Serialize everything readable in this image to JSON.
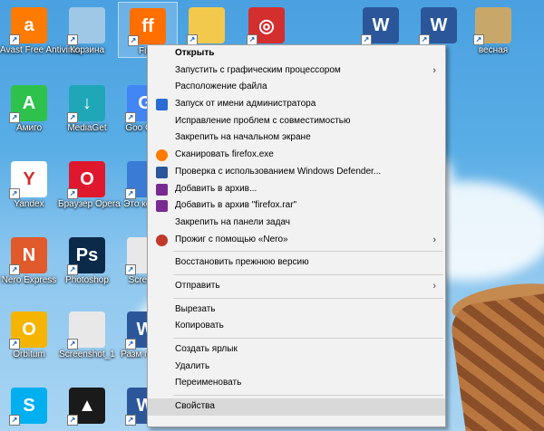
{
  "desktop_icons": [
    {
      "label": "Avast Free Antivirus",
      "color": "#ff7a00",
      "glyph": "a"
    },
    {
      "label": "Корзина",
      "color": "#9fc8e6",
      "glyph": ""
    },
    {
      "label": "Firef",
      "color": "#ff6f00",
      "glyph": "ff"
    },
    {
      "label": "",
      "color": "#f2c94c",
      "glyph": ""
    },
    {
      "label": "",
      "color": "#d32f2f",
      "glyph": "◎"
    },
    {
      "label": "",
      "color": "#2b579a",
      "glyph": "W"
    },
    {
      "label": "",
      "color": "#2b579a",
      "glyph": "W"
    },
    {
      "label": "весная",
      "color": "#c8a86a",
      "glyph": ""
    },
    {
      "label": "Амиго",
      "color": "#2ec24c",
      "glyph": "A"
    },
    {
      "label": "MediaGet",
      "color": "#1fa7b8",
      "glyph": "↓"
    },
    {
      "label": "Goo Chro",
      "color": "#4285f4",
      "glyph": "G"
    },
    {
      "label": "Yandex",
      "color": "#ffffff",
      "glyph": "Y"
    },
    {
      "label": "Браузер Opera",
      "color": "#e0182d",
      "glyph": "O"
    },
    {
      "label": "Это компь",
      "color": "#3a7bd5",
      "glyph": ""
    },
    {
      "label": "Nero Express",
      "color": "#e05a2b",
      "glyph": "N"
    },
    {
      "label": "Photoshop",
      "color": "#0b2a4a",
      "glyph": "Ps"
    },
    {
      "label": "Screens",
      "color": "#e8e8e8",
      "glyph": ""
    },
    {
      "label": "Orbitum",
      "color": "#f4b400",
      "glyph": "O"
    },
    {
      "label": "Screenshot_1",
      "color": "#e8e8e8",
      "glyph": ""
    },
    {
      "label": "Разм перед",
      "color": "#2b579a",
      "glyph": "W"
    },
    {
      "label": "",
      "color": "#00aff0",
      "glyph": "S"
    },
    {
      "label": "",
      "color": "#1a1a1a",
      "glyph": "▲"
    },
    {
      "label": "",
      "color": "#2b579a",
      "glyph": "W"
    }
  ],
  "menu": {
    "items": [
      {
        "label": "Открыть",
        "bold": true
      },
      {
        "label": "Запустить с графическим процессором",
        "submenu": true
      },
      {
        "label": "Расположение файла"
      },
      {
        "label": "Запуск от имени администратора",
        "icon": "shield-icon"
      },
      {
        "label": "Исправление проблем с совместимостью"
      },
      {
        "label": "Закрепить на начальном экране"
      },
      {
        "label": "Сканировать firefox.exe",
        "icon": "avast-icon"
      },
      {
        "label": "Проверка с использованием Windows Defender...",
        "icon": "defender-icon"
      },
      {
        "label": "Добавить в архив...",
        "icon": "winrar-icon"
      },
      {
        "label": "Добавить в архив \"firefox.rar\"",
        "icon": "winrar-icon"
      },
      {
        "label": "Закрепить на панели задач"
      },
      {
        "label": "Прожиг с помощью «Nero»",
        "icon": "nero-icon",
        "submenu": true
      },
      {
        "sep": true
      },
      {
        "label": "Восстановить прежнюю версию"
      },
      {
        "sep": true
      },
      {
        "label": "Отправить",
        "submenu": true
      },
      {
        "sep": true
      },
      {
        "label": "Вырезать"
      },
      {
        "label": "Копировать"
      },
      {
        "sep": true
      },
      {
        "label": "Создать ярлык"
      },
      {
        "label": "Удалить"
      },
      {
        "label": "Переименовать"
      },
      {
        "sep": true
      },
      {
        "label": "Свойства",
        "highlight": true
      }
    ],
    "submenu_glyph": "›"
  }
}
